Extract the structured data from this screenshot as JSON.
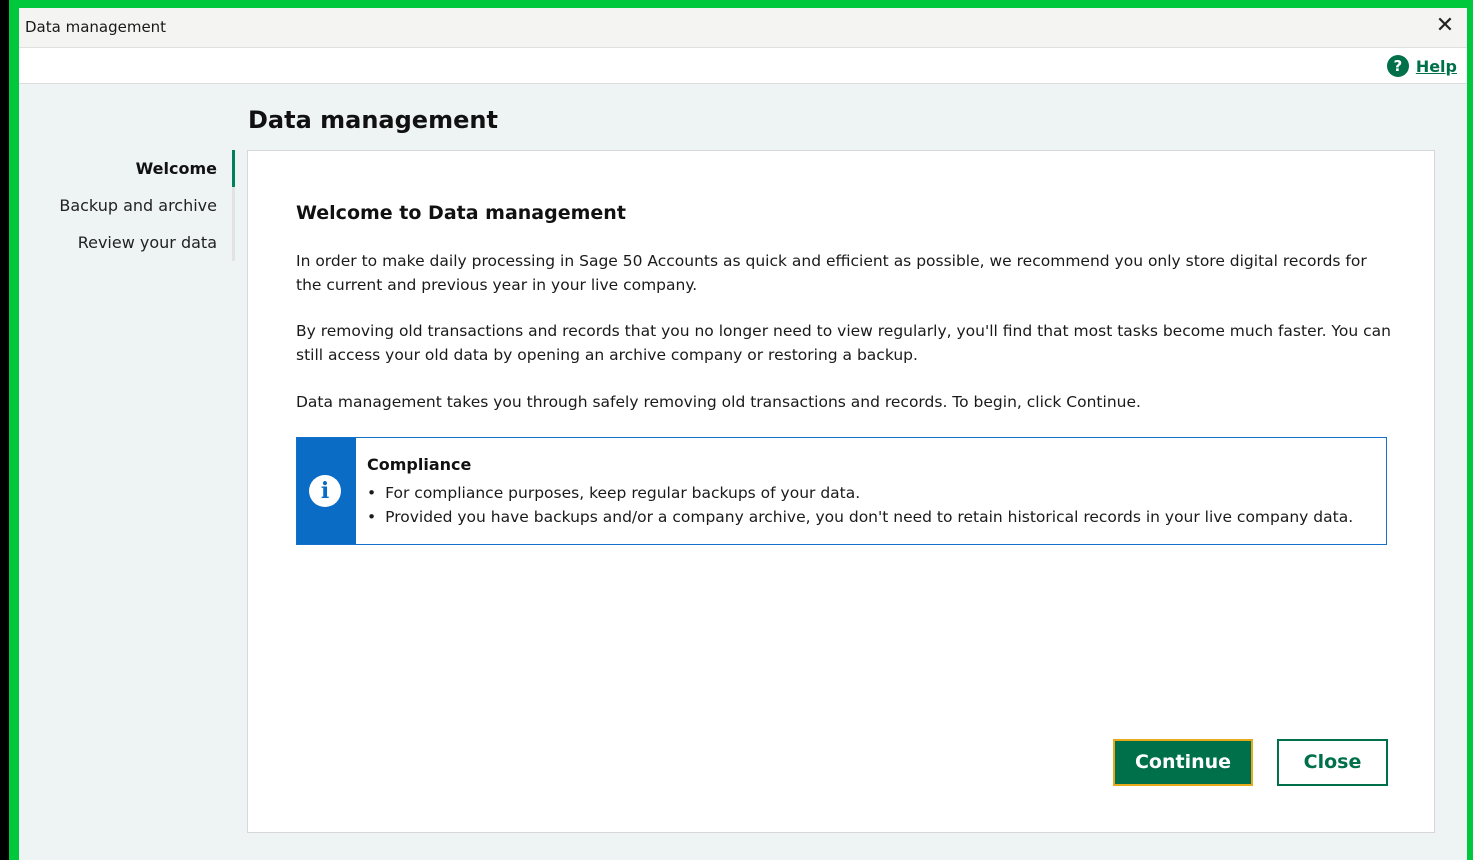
{
  "window": {
    "title": "Data management",
    "close_icon": "close-icon"
  },
  "help": {
    "icon": "question-circle-icon",
    "label": "Help"
  },
  "page_title": "Data management",
  "sidebar": {
    "items": [
      {
        "label": "Welcome",
        "active": true
      },
      {
        "label": "Backup and archive",
        "active": false
      },
      {
        "label": "Review your data",
        "active": false
      }
    ]
  },
  "content": {
    "heading": "Welcome to Data management",
    "paragraphs": [
      "In order to make daily processing in Sage 50 Accounts as quick and efficient as possible, we recommend you only store digital records for the current and previous year in your live company.",
      "By removing old transactions and records that you no longer need to view regularly, you'll find that most tasks become much faster. You can still access your old data by opening an archive company or restoring a backup.",
      "Data management takes you through safely removing old transactions and records. To begin, click Continue."
    ],
    "notice": {
      "icon": "info-icon",
      "title": "Compliance",
      "items": [
        "For compliance purposes, keep regular backups of your data.",
        "Provided you have backups and/or a company archive, you don't need to retain historical records in your live company data."
      ]
    }
  },
  "buttons": {
    "continue": "Continue",
    "close": "Close"
  },
  "colors": {
    "accent": "#00704a",
    "info": "#0a6cc4",
    "focus_border": "#e8a91a"
  }
}
